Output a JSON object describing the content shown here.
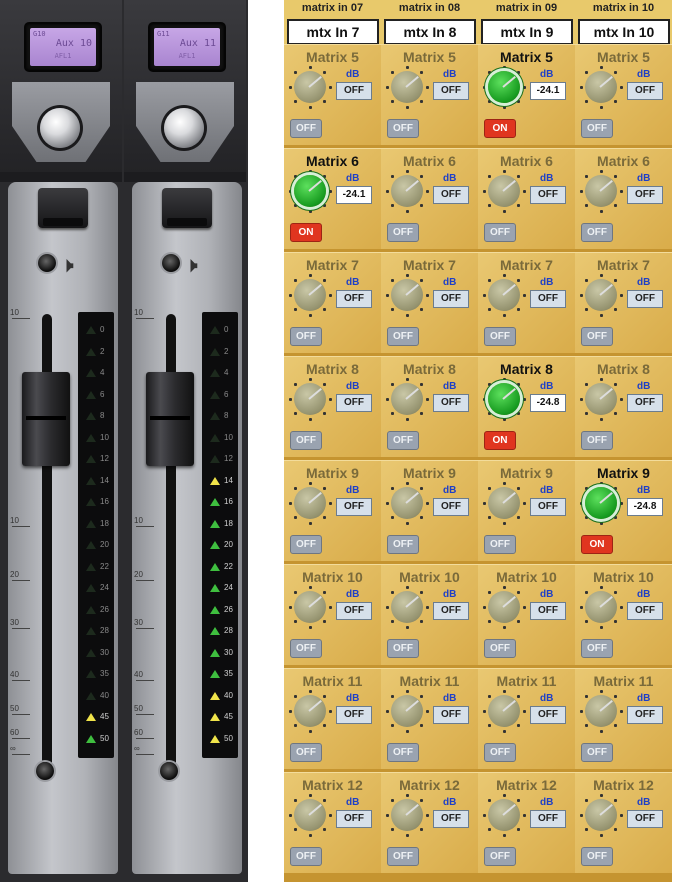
{
  "fader_panel": {
    "strips": [
      {
        "lcd_num": "G10",
        "lcd_name": "Aux 10",
        "lcd_sub": "AFL1"
      },
      {
        "lcd_num": "G11",
        "lcd_name": "Aux 11",
        "lcd_sub": "AFL1"
      }
    ],
    "fader_scale": [
      "10",
      "10",
      "20",
      "30",
      "40",
      "50",
      "60",
      "∞"
    ],
    "meter_labels": [
      "0",
      "2",
      "4",
      "6",
      "8",
      "10",
      "12",
      "14",
      "16",
      "18",
      "20",
      "22",
      "24",
      "26",
      "28",
      "30",
      "35",
      "40",
      "45",
      "50"
    ]
  },
  "matrix_grid": {
    "columns": [
      {
        "title": "matrix in 07",
        "name": "mtx In 7"
      },
      {
        "title": "matrix in 08",
        "name": "mtx In 8"
      },
      {
        "title": "matrix in 09",
        "name": "mtx In 9"
      },
      {
        "title": "matrix in 10",
        "name": "mtx In 10"
      }
    ],
    "db_label": "dB",
    "rows": [
      {
        "label": "Matrix 5",
        "cells": [
          {
            "value": "OFF",
            "state": "OFF"
          },
          {
            "value": "OFF",
            "state": "OFF"
          },
          {
            "value": "-24.1",
            "state": "ON"
          },
          {
            "value": "OFF",
            "state": "OFF"
          }
        ]
      },
      {
        "label": "Matrix 6",
        "cells": [
          {
            "value": "-24.1",
            "state": "ON"
          },
          {
            "value": "OFF",
            "state": "OFF"
          },
          {
            "value": "OFF",
            "state": "OFF"
          },
          {
            "value": "OFF",
            "state": "OFF"
          }
        ]
      },
      {
        "label": "Matrix 7",
        "cells": [
          {
            "value": "OFF",
            "state": "OFF"
          },
          {
            "value": "OFF",
            "state": "OFF"
          },
          {
            "value": "OFF",
            "state": "OFF"
          },
          {
            "value": "OFF",
            "state": "OFF"
          }
        ]
      },
      {
        "label": "Matrix 8",
        "cells": [
          {
            "value": "OFF",
            "state": "OFF"
          },
          {
            "value": "OFF",
            "state": "OFF"
          },
          {
            "value": "-24.8",
            "state": "ON"
          },
          {
            "value": "OFF",
            "state": "OFF"
          }
        ]
      },
      {
        "label": "Matrix 9",
        "cells": [
          {
            "value": "OFF",
            "state": "OFF"
          },
          {
            "value": "OFF",
            "state": "OFF"
          },
          {
            "value": "OFF",
            "state": "OFF"
          },
          {
            "value": "-24.8",
            "state": "ON"
          }
        ]
      },
      {
        "label": "Matrix 10",
        "cells": [
          {
            "value": "OFF",
            "state": "OFF"
          },
          {
            "value": "OFF",
            "state": "OFF"
          },
          {
            "value": "OFF",
            "state": "OFF"
          },
          {
            "value": "OFF",
            "state": "OFF"
          }
        ]
      },
      {
        "label": "Matrix 11",
        "cells": [
          {
            "value": "OFF",
            "state": "OFF"
          },
          {
            "value": "OFF",
            "state": "OFF"
          },
          {
            "value": "OFF",
            "state": "OFF"
          },
          {
            "value": "OFF",
            "state": "OFF"
          }
        ]
      },
      {
        "label": "Matrix 12",
        "cells": [
          {
            "value": "OFF",
            "state": "OFF"
          },
          {
            "value": "OFF",
            "state": "OFF"
          },
          {
            "value": "OFF",
            "state": "OFF"
          },
          {
            "value": "OFF",
            "state": "OFF"
          }
        ]
      }
    ]
  },
  "colors": {
    "on": "#e0351f",
    "off": "#9aa3b0",
    "active_dial": "#169a1f",
    "gold": "#d9ac4a"
  }
}
